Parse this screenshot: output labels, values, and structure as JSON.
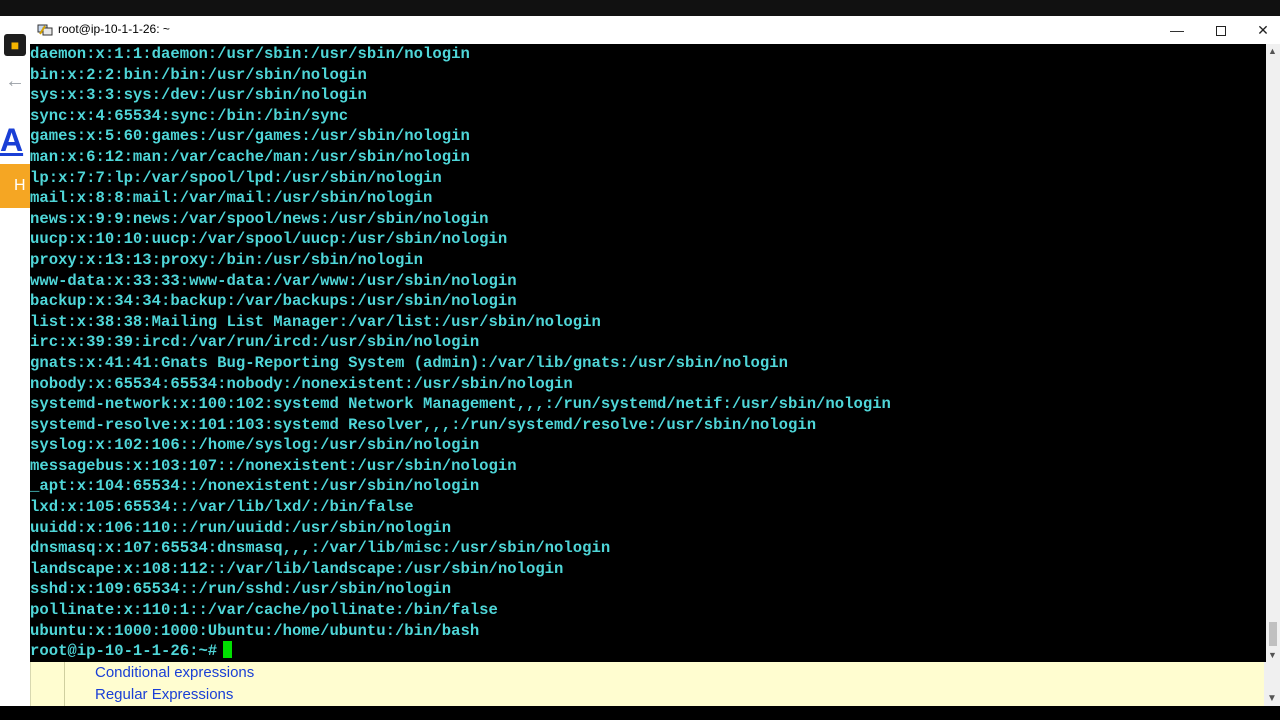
{
  "background": {
    "logo_text": "A",
    "orange_tab_text": "H",
    "links": [
      "Conditional expressions",
      "Regular Expressions"
    ]
  },
  "terminal": {
    "title": "root@ip-10-1-1-26: ~",
    "lines": [
      "daemon:x:1:1:daemon:/usr/sbin:/usr/sbin/nologin",
      "bin:x:2:2:bin:/bin:/usr/sbin/nologin",
      "sys:x:3:3:sys:/dev:/usr/sbin/nologin",
      "sync:x:4:65534:sync:/bin:/bin/sync",
      "games:x:5:60:games:/usr/games:/usr/sbin/nologin",
      "man:x:6:12:man:/var/cache/man:/usr/sbin/nologin",
      "lp:x:7:7:lp:/var/spool/lpd:/usr/sbin/nologin",
      "mail:x:8:8:mail:/var/mail:/usr/sbin/nologin",
      "news:x:9:9:news:/var/spool/news:/usr/sbin/nologin",
      "uucp:x:10:10:uucp:/var/spool/uucp:/usr/sbin/nologin",
      "proxy:x:13:13:proxy:/bin:/usr/sbin/nologin",
      "www-data:x:33:33:www-data:/var/www:/usr/sbin/nologin",
      "backup:x:34:34:backup:/var/backups:/usr/sbin/nologin",
      "list:x:38:38:Mailing List Manager:/var/list:/usr/sbin/nologin",
      "irc:x:39:39:ircd:/var/run/ircd:/usr/sbin/nologin",
      "gnats:x:41:41:Gnats Bug-Reporting System (admin):/var/lib/gnats:/usr/sbin/nologin",
      "nobody:x:65534:65534:nobody:/nonexistent:/usr/sbin/nologin",
      "systemd-network:x:100:102:systemd Network Management,,,:/run/systemd/netif:/usr/sbin/nologin",
      "systemd-resolve:x:101:103:systemd Resolver,,,:/run/systemd/resolve:/usr/sbin/nologin",
      "syslog:x:102:106::/home/syslog:/usr/sbin/nologin",
      "messagebus:x:103:107::/nonexistent:/usr/sbin/nologin",
      "_apt:x:104:65534::/nonexistent:/usr/sbin/nologin",
      "lxd:x:105:65534::/var/lib/lxd/:/bin/false",
      "uuidd:x:106:110::/run/uuidd:/usr/sbin/nologin",
      "dnsmasq:x:107:65534:dnsmasq,,,:/var/lib/misc:/usr/sbin/nologin",
      "landscape:x:108:112::/var/lib/landscape:/usr/sbin/nologin",
      "sshd:x:109:65534::/run/sshd:/usr/sbin/nologin",
      "pollinate:x:110:1::/var/cache/pollinate:/bin/false",
      "ubuntu:x:1000:1000:Ubuntu:/home/ubuntu:/bin/bash"
    ],
    "prompt": "root@ip-10-1-1-26:~#",
    "text_color": "#4fd6d8",
    "cursor_color": "#00e000"
  }
}
